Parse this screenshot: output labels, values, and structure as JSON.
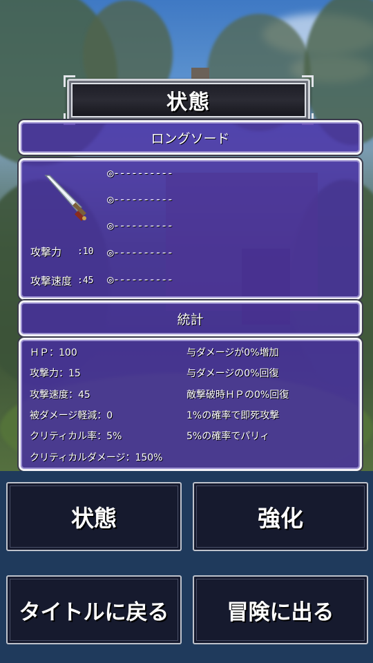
{
  "title": "状態",
  "weapon": {
    "name": "ロングソード",
    "icon": "sword-icon",
    "attack_label": "攻撃力",
    "attack_value": ":10",
    "speed_label": "攻撃速度",
    "speed_value": ":45",
    "slots": [
      "◎----------",
      "◎----------",
      "◎----------",
      "◎----------",
      "◎----------"
    ]
  },
  "stats": {
    "header": "統計",
    "left": [
      "ＨＰ：100",
      "攻撃力：15",
      "攻撃速度：45",
      "被ダメージ軽減：0",
      "クリティカル率：5%",
      "クリティカルダメージ：150%"
    ],
    "right": [
      "与ダメージが0%増加",
      "与ダメージの0%回復",
      "敵撃破時ＨＰの0%回復",
      "1%の確率で即死攻撃",
      "5%の確率でパリィ"
    ]
  },
  "menu": {
    "status": "状態",
    "upgrade": "強化",
    "back_to_title": "タイトルに戻る",
    "go_adventure": "冒険に出る"
  },
  "colors": {
    "panel": "#482ca8",
    "menu_bg": "#1f3a5c",
    "button_bg": "#161a2e"
  }
}
